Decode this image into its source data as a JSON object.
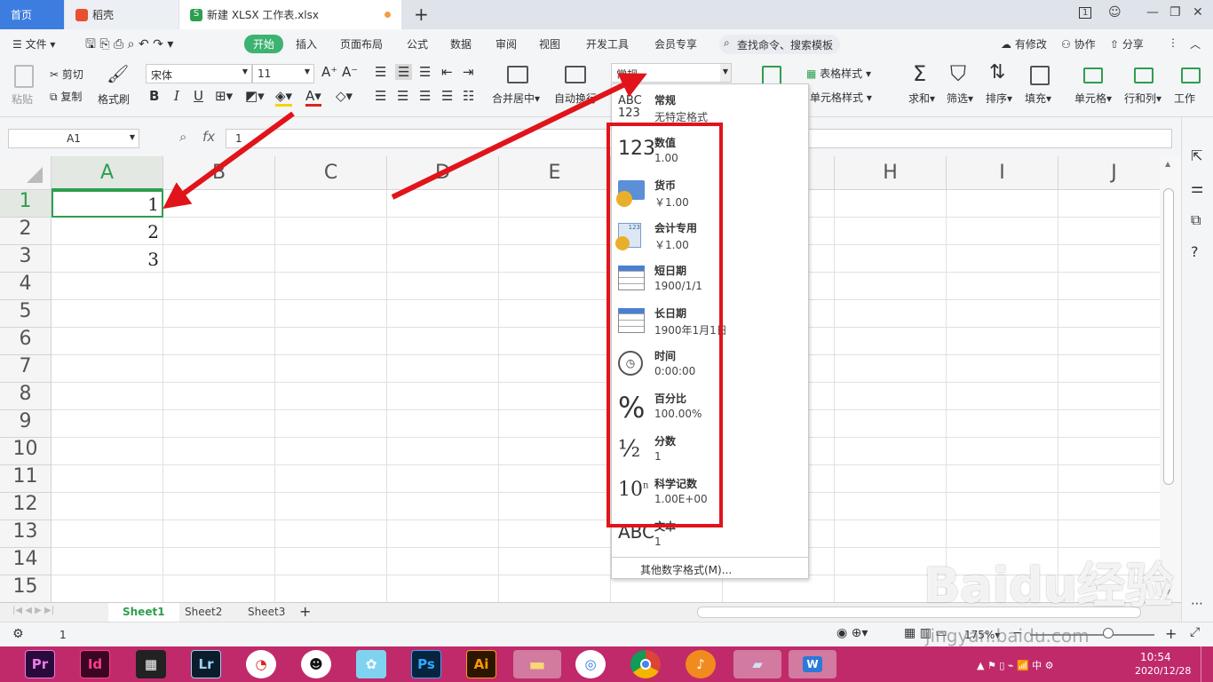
{
  "titlebar": {
    "tabs": [
      {
        "label": "首页"
      },
      {
        "label": "稻壳"
      },
      {
        "label": "新建 XLSX 工作表.xlsx"
      }
    ],
    "page_count": "1"
  },
  "menu": {
    "file": "文件",
    "items": [
      "开始",
      "插入",
      "页面布局",
      "公式",
      "数据",
      "审阅",
      "视图",
      "开发工具",
      "会员专享"
    ],
    "search": "查找命令、搜索模板",
    "right": [
      "有修改",
      "协作",
      "分享"
    ]
  },
  "ribbon": {
    "paste": "粘贴",
    "cut": "剪切",
    "copy": "复制",
    "format_painter": "格式刷",
    "font": "宋体",
    "size": "11",
    "merge": "合并居中",
    "wrap": "自动换行",
    "number_format": "常规",
    "table_style": "表格样式",
    "cell_style": "单元格样式",
    "sum": "求和",
    "filter": "筛选",
    "sort": "排序",
    "fill": "填充",
    "cell": "单元格",
    "rowcol": "行和列",
    "worksheet": "工作"
  },
  "formula_bar": {
    "name_box": "A1",
    "fx": "fx",
    "value": "1"
  },
  "grid": {
    "columns": [
      "A",
      "B",
      "C",
      "D",
      "E",
      "F",
      "G",
      "H",
      "I",
      "J"
    ],
    "rows": [
      "1",
      "2",
      "3",
      "4",
      "5",
      "6",
      "7",
      "8",
      "9",
      "10",
      "11",
      "12",
      "13",
      "14",
      "15"
    ],
    "values": [
      "1",
      "2",
      "3"
    ]
  },
  "sheets": [
    "Sheet1",
    "Sheet2",
    "Sheet3"
  ],
  "status": {
    "value": "1",
    "zoom": "175%"
  },
  "dropdown": {
    "items": [
      {
        "name": "常规",
        "example": "无特定格式",
        "icon": "abc-123-icon"
      },
      {
        "name": "数值",
        "example": "1.00",
        "icon": "number-icon"
      },
      {
        "name": "货币",
        "example": "￥1.00",
        "icon": "currency-icon"
      },
      {
        "name": "会计专用",
        "example": "￥1.00",
        "icon": "accounting-icon"
      },
      {
        "name": "短日期",
        "example": "1900/1/1",
        "icon": "calendar-icon"
      },
      {
        "name": "长日期",
        "example": "1900年1月1日",
        "icon": "calendar-icon"
      },
      {
        "name": "时间",
        "example": "0:00:00",
        "icon": "clock-icon"
      },
      {
        "name": "百分比",
        "example": "100.00%",
        "icon": "percent-icon"
      },
      {
        "name": "分数",
        "example": "1",
        "icon": "fraction-icon"
      },
      {
        "name": "科学记数",
        "example": "1.00E+00",
        "icon": "scientific-icon"
      },
      {
        "name": "文本",
        "example": "1",
        "icon": "text-icon"
      }
    ],
    "more": "其他数字格式(M)..."
  },
  "taskbar": {
    "apps": [
      "Pr",
      "Id",
      "",
      "Lr",
      "",
      "",
      "",
      "Ps",
      "Ai"
    ],
    "time": "10:54",
    "date": "2020/12/28"
  },
  "watermark": {
    "brand": "Baidu经验",
    "url": "jingyan.baidu.com"
  }
}
